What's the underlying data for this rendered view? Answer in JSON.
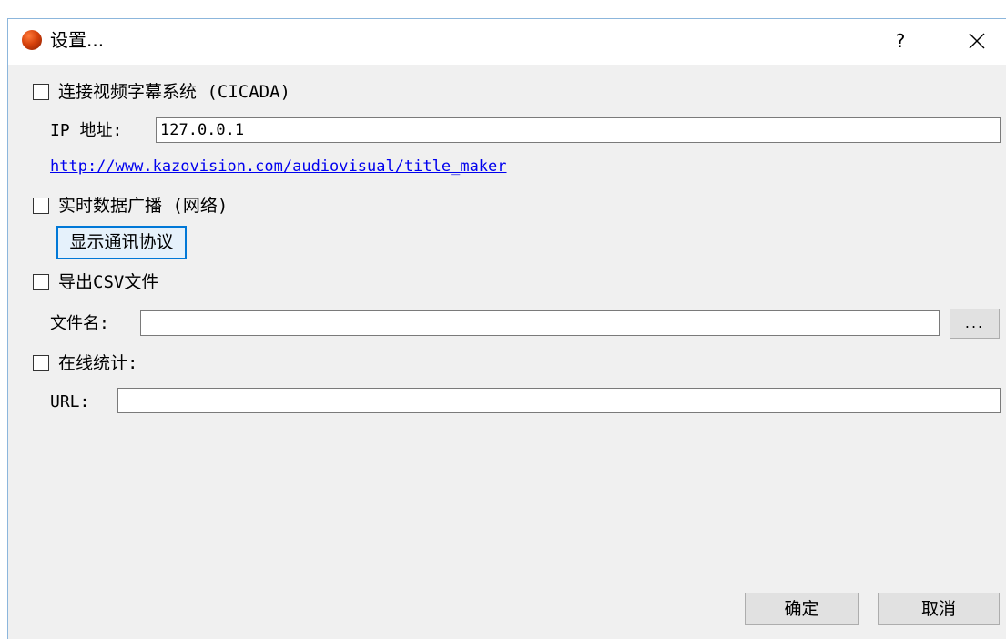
{
  "window": {
    "title": "设置...",
    "help_label": "?"
  },
  "cicada": {
    "checkbox_label": "连接视频字幕系统 (CICADA)",
    "ip_label": "IP 地址:",
    "ip_value": "127.0.0.1",
    "link_text": "http://www.kazovision.com/audiovisual/title_maker"
  },
  "broadcast": {
    "checkbox_label": "实时数据广播 (网络)",
    "protocol_button": "显示通讯协议"
  },
  "csv": {
    "checkbox_label": "导出CSV文件",
    "filename_label": "文件名:",
    "filename_value": "",
    "browse_button": "..."
  },
  "online": {
    "checkbox_label": "在线统计:",
    "url_label": "URL:",
    "url_value": ""
  },
  "footer": {
    "ok_label": "确定",
    "cancel_label": "取消"
  },
  "colors": {
    "dialog_bg": "#f0f0f0",
    "link": "#0000ee",
    "focus_border": "#0078d7"
  }
}
